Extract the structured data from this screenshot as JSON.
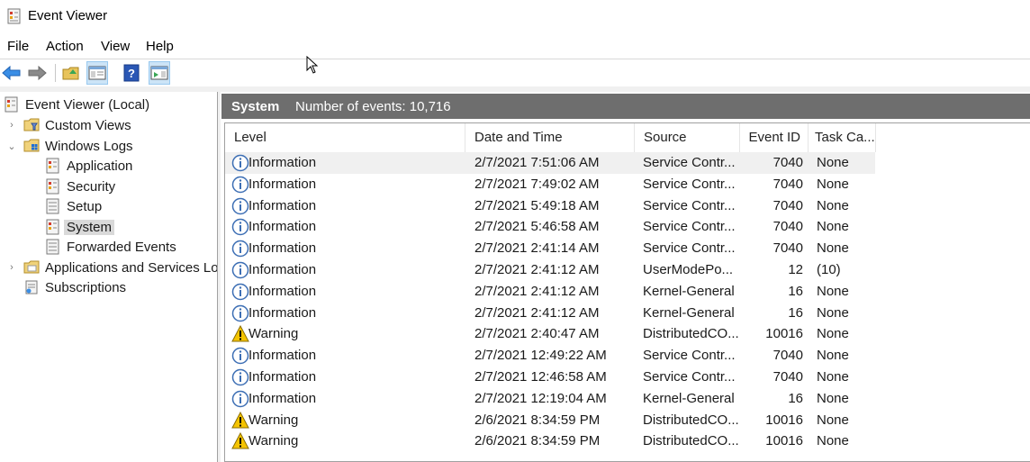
{
  "window": {
    "title": "Event Viewer"
  },
  "menu": [
    "File",
    "Action",
    "View",
    "Help"
  ],
  "toolbar": {
    "buttons": [
      "back-arrow-icon",
      "forward-arrow-icon",
      "open-folder-icon",
      "show-hide-tree-icon",
      "help-icon",
      "show-hide-action-pane-icon"
    ]
  },
  "tree": {
    "root": "Event Viewer (Local)",
    "custom_views": "Custom Views",
    "windows_logs": "Windows Logs",
    "application": "Application",
    "security": "Security",
    "setup": "Setup",
    "system": "System",
    "forwarded_events": "Forwarded Events",
    "apps_services": "Applications and Services Logs",
    "subscriptions": "Subscriptions"
  },
  "header": {
    "title": "System",
    "count_text": "Number of events: 10,716"
  },
  "columns": {
    "level": "Level",
    "datetime": "Date and Time",
    "source": "Source",
    "event_id": "Event ID",
    "task": "Task Ca..."
  },
  "rows": [
    {
      "level": "Information",
      "datetime": "2/7/2021 7:51:06 AM",
      "source": "Service Contr...",
      "event_id": "7040",
      "task": "None",
      "type": "info"
    },
    {
      "level": "Information",
      "datetime": "2/7/2021 7:49:02 AM",
      "source": "Service Contr...",
      "event_id": "7040",
      "task": "None",
      "type": "info"
    },
    {
      "level": "Information",
      "datetime": "2/7/2021 5:49:18 AM",
      "source": "Service Contr...",
      "event_id": "7040",
      "task": "None",
      "type": "info"
    },
    {
      "level": "Information",
      "datetime": "2/7/2021 5:46:58 AM",
      "source": "Service Contr...",
      "event_id": "7040",
      "task": "None",
      "type": "info"
    },
    {
      "level": "Information",
      "datetime": "2/7/2021 2:41:14 AM",
      "source": "Service Contr...",
      "event_id": "7040",
      "task": "None",
      "type": "info"
    },
    {
      "level": "Information",
      "datetime": "2/7/2021 2:41:12 AM",
      "source": "UserModePo...",
      "event_id": "12",
      "task": "(10)",
      "type": "info"
    },
    {
      "level": "Information",
      "datetime": "2/7/2021 2:41:12 AM",
      "source": "Kernel-General",
      "event_id": "16",
      "task": "None",
      "type": "info"
    },
    {
      "level": "Information",
      "datetime": "2/7/2021 2:41:12 AM",
      "source": "Kernel-General",
      "event_id": "16",
      "task": "None",
      "type": "info"
    },
    {
      "level": "Warning",
      "datetime": "2/7/2021 2:40:47 AM",
      "source": "DistributedCO...",
      "event_id": "10016",
      "task": "None",
      "type": "warning"
    },
    {
      "level": "Information",
      "datetime": "2/7/2021 12:49:22 AM",
      "source": "Service Contr...",
      "event_id": "7040",
      "task": "None",
      "type": "info"
    },
    {
      "level": "Information",
      "datetime": "2/7/2021 12:46:58 AM",
      "source": "Service Contr...",
      "event_id": "7040",
      "task": "None",
      "type": "info"
    },
    {
      "level": "Information",
      "datetime": "2/7/2021 12:19:04 AM",
      "source": "Kernel-General",
      "event_id": "16",
      "task": "None",
      "type": "info"
    },
    {
      "level": "Warning",
      "datetime": "2/6/2021 8:34:59 PM",
      "source": "DistributedCO...",
      "event_id": "10016",
      "task": "None",
      "type": "warning"
    },
    {
      "level": "Warning",
      "datetime": "2/6/2021 8:34:59 PM",
      "source": "DistributedCO...",
      "event_id": "10016",
      "task": "None",
      "type": "warning"
    }
  ],
  "colors": {
    "header_bar": "#6e6e6e",
    "selection": "#f0f0f0",
    "info_icon": "#3c6eb4",
    "warning_icon": "#f5c400"
  }
}
